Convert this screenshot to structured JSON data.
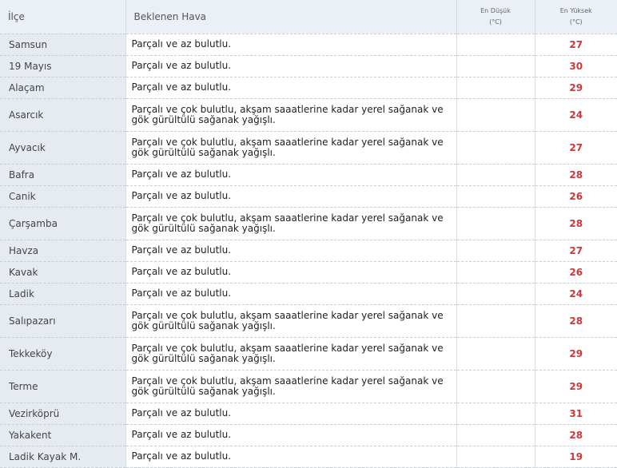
{
  "headers": {
    "district": "İlçe",
    "weather": "Beklenen Hava",
    "low_line1": "En Düşük",
    "low_line2": "(°C)",
    "high_line1": "En Yüksek",
    "high_line2": "(°C)"
  },
  "rows": [
    {
      "district": "Samsun",
      "weather": "Parçalı ve az bulutlu.",
      "low": "",
      "high": "27"
    },
    {
      "district": "19 Mayıs",
      "weather": "Parçalı ve az bulutlu.",
      "low": "",
      "high": "30"
    },
    {
      "district": "Alaçam",
      "weather": "Parçalı ve az bulutlu.",
      "low": "",
      "high": "29"
    },
    {
      "district": "Asarcık",
      "weather": "Parçalı ve çok bulutlu, akşam saaatlerine kadar yerel sağanak ve gök gürültülü sağanak yağışlı.",
      "low": "",
      "high": "24"
    },
    {
      "district": "Ayvacık",
      "weather": "Parçalı ve çok bulutlu, akşam saaatlerine kadar yerel sağanak ve gök gürültülü sağanak yağışlı.",
      "low": "",
      "high": "27"
    },
    {
      "district": "Bafra",
      "weather": "Parçalı ve az bulutlu.",
      "low": "",
      "high": "28"
    },
    {
      "district": "Canik",
      "weather": "Parçalı ve az bulutlu.",
      "low": "",
      "high": "26"
    },
    {
      "district": "Çarşamba",
      "weather": "Parçalı ve çok bulutlu, akşam saaatlerine kadar yerel sağanak ve gök gürültülü sağanak yağışlı.",
      "low": "",
      "high": "28"
    },
    {
      "district": "Havza",
      "weather": "Parçalı ve az bulutlu.",
      "low": "",
      "high": "27"
    },
    {
      "district": "Kavak",
      "weather": "Parçalı ve az bulutlu.",
      "low": "",
      "high": "26"
    },
    {
      "district": "Ladik",
      "weather": "Parçalı ve az bulutlu.",
      "low": "",
      "high": "24"
    },
    {
      "district": "Salıpazarı",
      "weather": "Parçalı ve çok bulutlu, akşam saaatlerine kadar yerel sağanak ve gök gürültülü sağanak yağışlı.",
      "low": "",
      "high": "28"
    },
    {
      "district": "Tekkeköy",
      "weather": "Parçalı ve çok bulutlu, akşam saaatlerine kadar yerel sağanak ve gök gürültülü sağanak yağışlı.",
      "low": "",
      "high": "29"
    },
    {
      "district": "Terme",
      "weather": "Parçalı ve çok bulutlu, akşam saaatlerine kadar yerel sağanak ve gök gürültülü sağanak yağışlı.",
      "low": "",
      "high": "29"
    },
    {
      "district": "Vezirköprü",
      "weather": "Parçalı ve az bulutlu.",
      "low": "",
      "high": "31"
    },
    {
      "district": "Yakakent",
      "weather": "Parçalı ve az bulutlu.",
      "low": "",
      "high": "28"
    },
    {
      "district": "Ladik Kayak M.",
      "weather": "Parçalı ve az bulutlu.",
      "low": "",
      "high": "19"
    }
  ],
  "colors": {
    "high_temp": "#d0363a",
    "district_bg": "#e6ebf1",
    "header_bg": "#eaf0f5"
  }
}
